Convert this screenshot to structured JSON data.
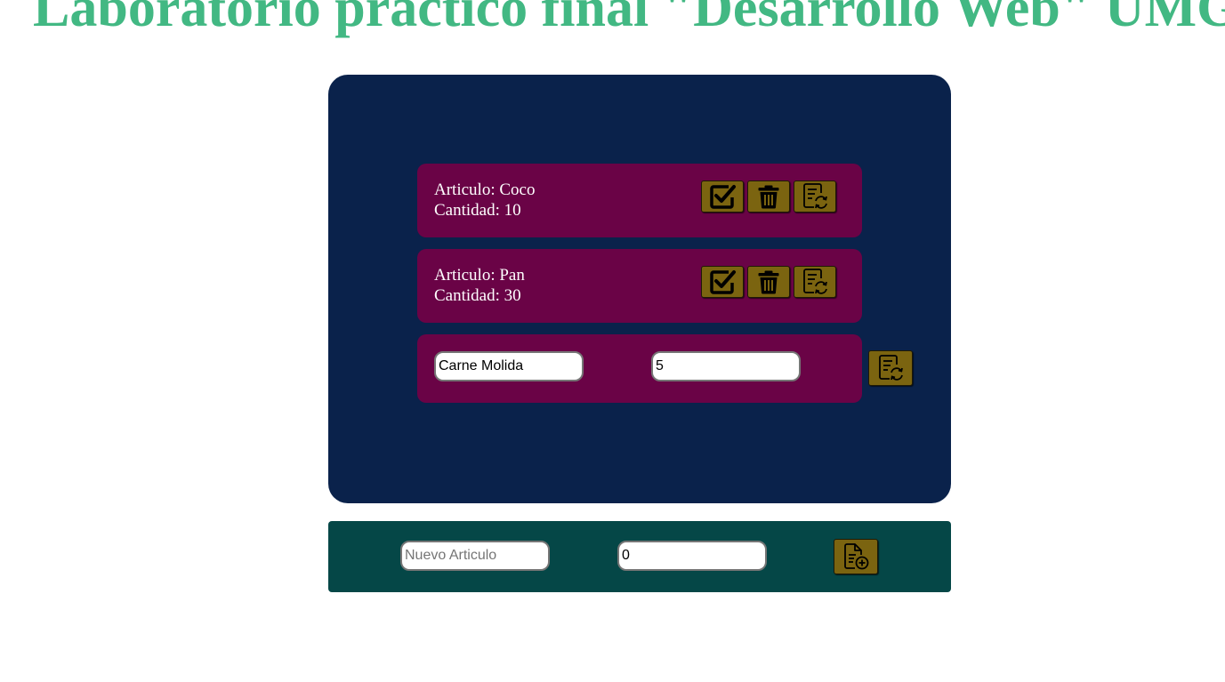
{
  "page": {
    "title": "Laboratorio practico final \"Desarrollo Web\" UMG"
  },
  "items": [
    {
      "article_label": "Articulo: Coco",
      "quantity_label": "Cantidad: 10"
    },
    {
      "article_label": "Articulo: Pan",
      "quantity_label": "Cantidad: 30"
    }
  ],
  "edit_row": {
    "article_value": "Carne Molida",
    "quantity_value": "5"
  },
  "add_form": {
    "article_placeholder": "Nuevo Articulo",
    "article_value": "",
    "quantity_value": "0"
  },
  "icons": {
    "complete": "check-square-icon",
    "delete": "trash-icon",
    "edit": "document-refresh-icon",
    "add": "document-add-icon"
  },
  "colors": {
    "title": "#42b883",
    "panel": "#0a224b",
    "card": "#6a0346",
    "button": "#7b6410",
    "add_bar": "#054747"
  }
}
